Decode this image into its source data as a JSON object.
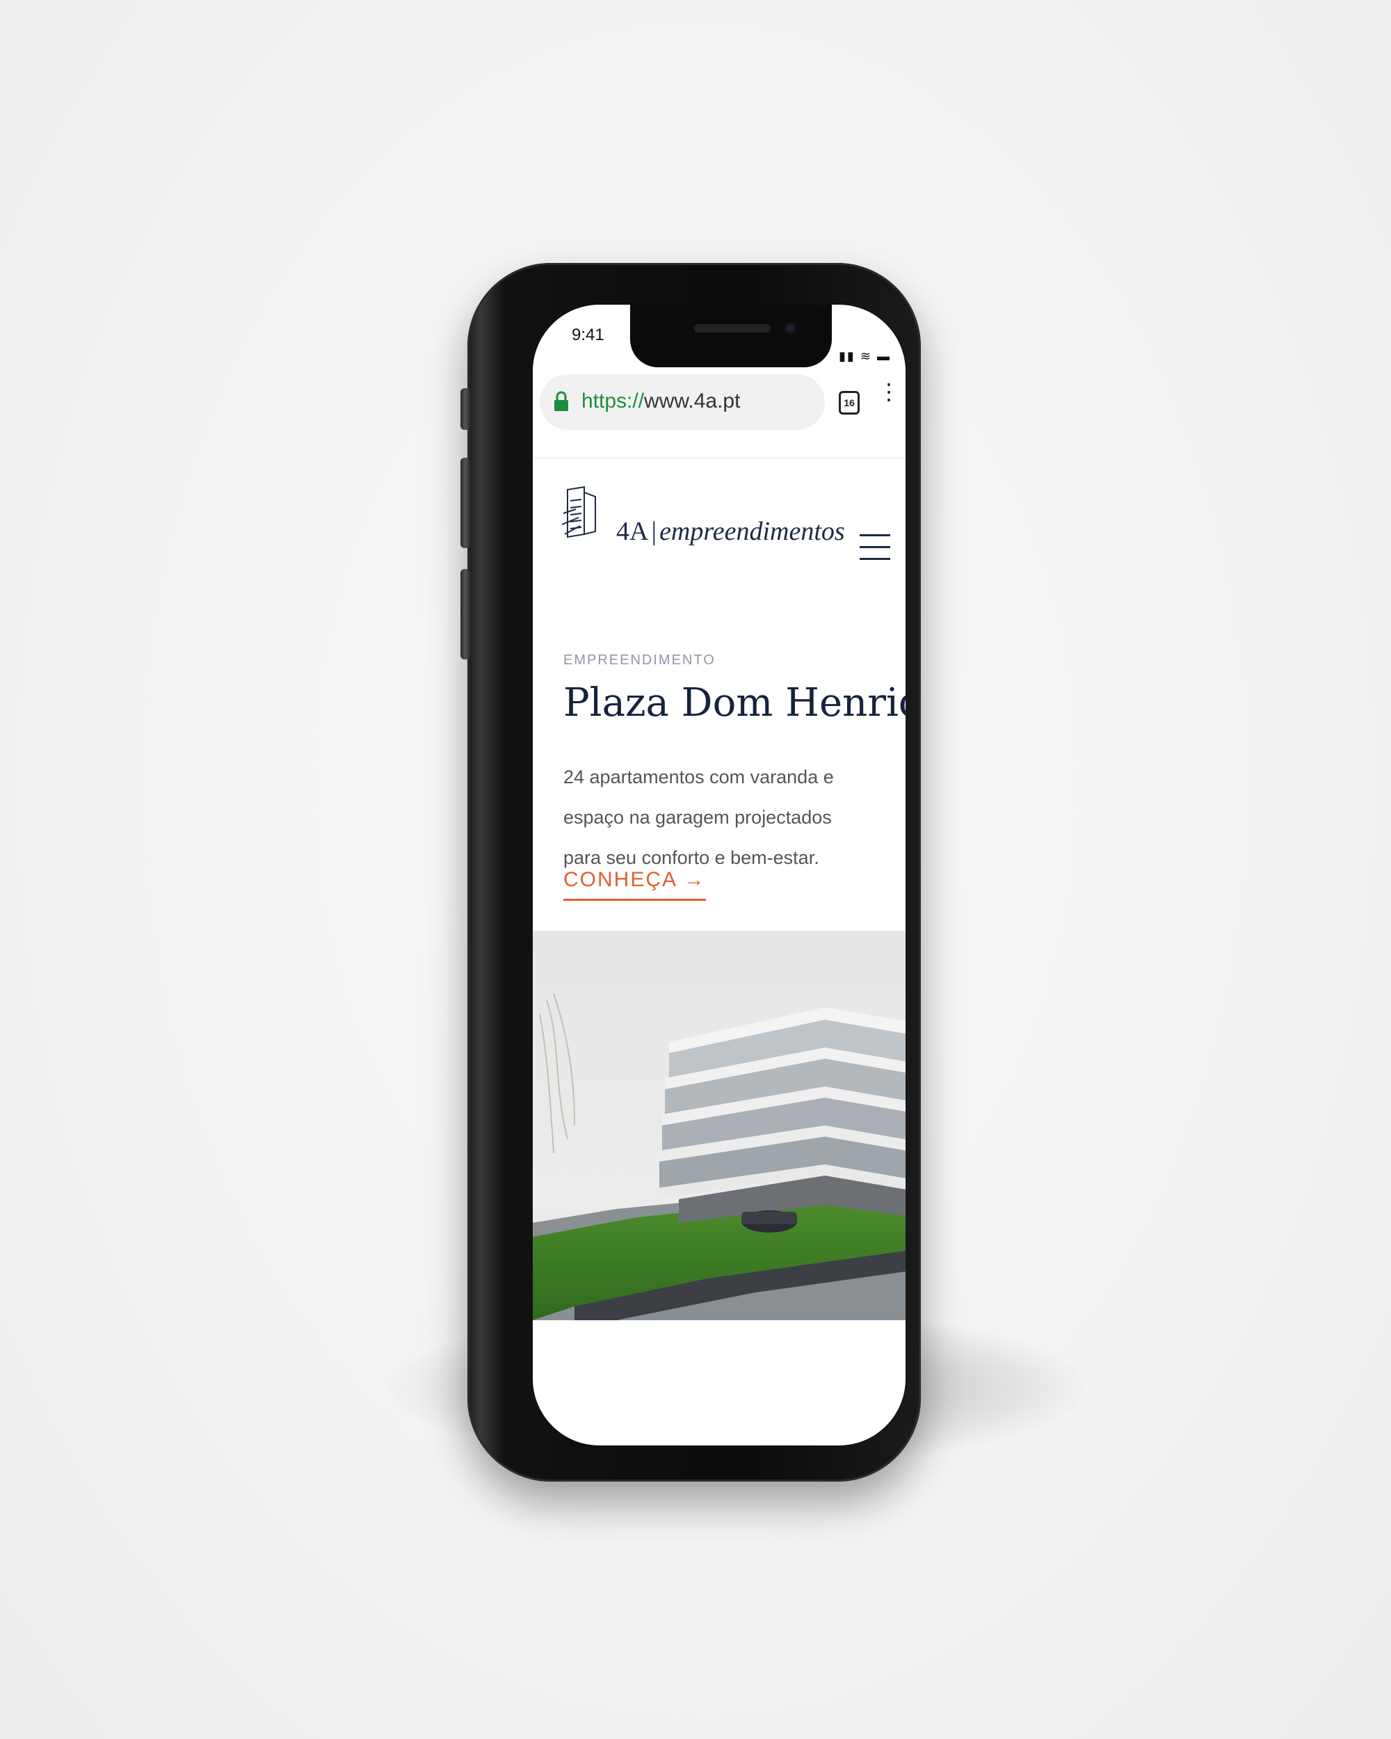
{
  "status_bar": {
    "time": "9:41"
  },
  "browser": {
    "url_scheme": "https://",
    "url_host": "www.4a.pt",
    "tab_count": "16"
  },
  "logo": {
    "brand": "4A",
    "separator": "|",
    "word": "empreendimentos"
  },
  "hero": {
    "eyebrow": "EMPREENDIMENTO",
    "title": "Plaza Dom Henrique",
    "description": "24 apartamentos com varanda e espaço na garagem projectados para seu conforto e bem-estar.",
    "cta_label": "CONHEÇA",
    "cta_arrow": "→"
  },
  "icons": [
    "lock-icon",
    "tabs-icon",
    "menu-dots-icon",
    "hamburger-icon",
    "logo-building-icon",
    "arrow-right-icon",
    "signal-icon",
    "wifi-icon",
    "battery-icon"
  ],
  "colors": {
    "navy": "#16233d",
    "accent": "#e2602e",
    "url_green": "#1e8e3e",
    "eyebrow_gray": "#8f98a6"
  }
}
